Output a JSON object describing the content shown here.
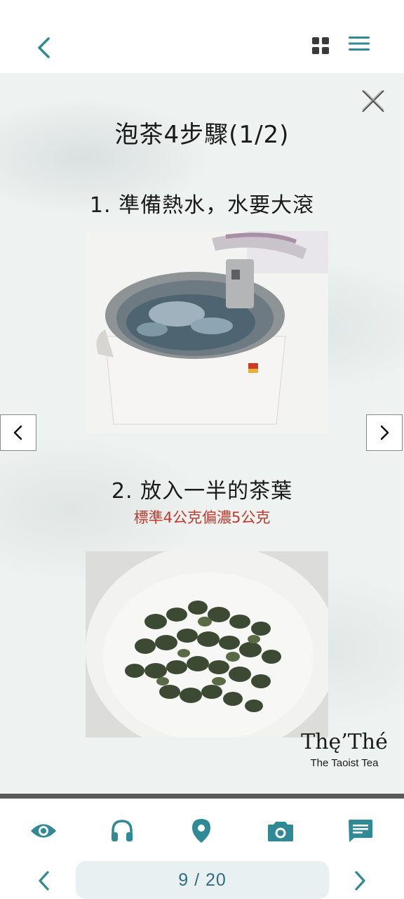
{
  "colors": {
    "accent": "#2f8a96",
    "status_dot": "#2ecc71",
    "note_red": "#c0392b"
  },
  "header": {
    "back_icon": "chevron-left-icon",
    "grid_icon": "grid-view-icon",
    "menu_icon": "hamburger-menu-icon"
  },
  "page": {
    "title": "泡茶4步驟(1/2)",
    "step1": "1. 準備熱水，水要大滾",
    "step2": "2. 放入一半的茶葉",
    "step2_note": "標準4公克偏濃5公克",
    "brand_logo": "Thę’Thé",
    "brand_sub": "The Taoist Tea"
  },
  "toolbar": {
    "icons": [
      "eye-icon",
      "headphones-icon",
      "location-pin-icon",
      "camera-icon",
      "chat-message-icon"
    ]
  },
  "pager": {
    "current": 9,
    "total": 20,
    "label": "9 / 20"
  }
}
